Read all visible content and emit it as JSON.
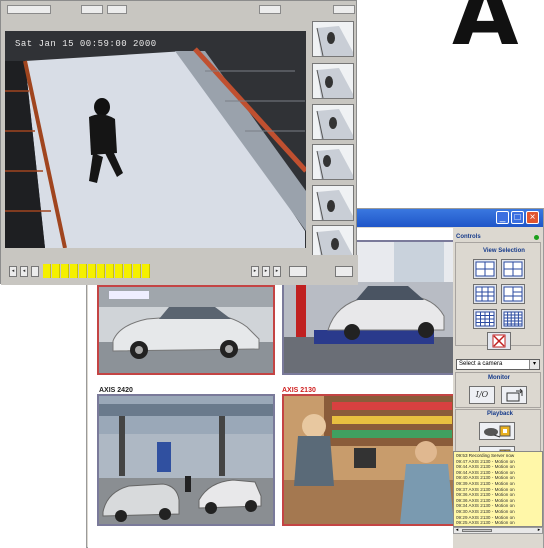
{
  "brand": {
    "letter": "A"
  },
  "player": {
    "toolbar": {
      "item1": "",
      "item2": "",
      "item3": "",
      "btn_right1": "",
      "btn_right2": ""
    },
    "timestamp": "Sat Jan 15   00:59:00  2000",
    "thumbnails_count": 6,
    "timeline_segments": 12,
    "nav_buttons": [
      "◂",
      "◂",
      "▸",
      "▸",
      "▸"
    ]
  },
  "viewer": {
    "window_buttons": [
      "_",
      "□",
      "×"
    ],
    "cameras": [
      {
        "label": "",
        "label_color": "#222222",
        "border": "#c44444"
      },
      {
        "label": "",
        "label_color": "#222222",
        "border": "#7a7a9a"
      },
      {
        "label": "AXIS 2420",
        "label_color": "#222222",
        "border": "#7a7a9a"
      },
      {
        "label": "AXIS 2130",
        "label_color": "#d02020",
        "border": "#c44444"
      }
    ],
    "controls": {
      "title": "Controls",
      "view_selection_title": "View Selection",
      "select_camera": "Select a camera",
      "monitor_title": "Monitor",
      "io_label": "I/O",
      "playback_title": "Playback"
    },
    "log": [
      "09:53 Recording Server now",
      "09:47 AXIS 2130 - Motion on",
      "09:44 AXIS 2130 - Motion on",
      "09:44 AXIS 2130 - Motion on",
      "09:40 AXIS 2130 - Motion on",
      "09:39 AXIS 2130 - Motion on",
      "09:37 AXIS 2130 - Motion on",
      "09:36 AXIS 2130 - Motion on",
      "09:36 AXIS 2130 - Motion on",
      "09:34 AXIS 2130 - Motion on",
      "09:30 AXIS 2130 - Motion on",
      "09:29 AXIS 2130 - Motion on",
      "09:25 AXIS 2130 - Motion on"
    ]
  }
}
